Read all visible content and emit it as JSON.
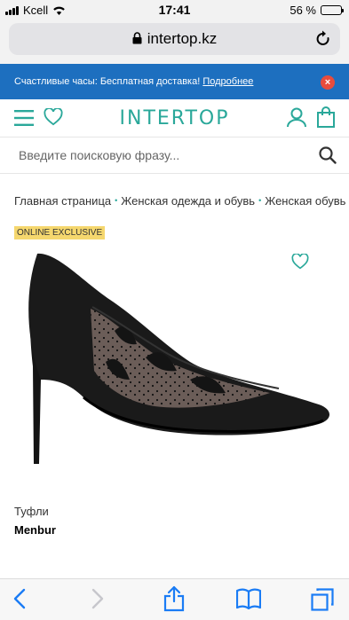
{
  "status": {
    "carrier": "Kcell",
    "time": "17:41",
    "battery": "56 %",
    "battery_level": 0.56
  },
  "browser": {
    "url": "intertop.kz"
  },
  "promo": {
    "text": "Счастливые часы: Бесплатная доставка!",
    "link": "Подробнее",
    "close": "×"
  },
  "header": {
    "logo": "INTERTOP"
  },
  "search": {
    "placeholder": "Введите поисковую фразу..."
  },
  "breadcrumb": [
    "Главная страница",
    "Женская одежда и обувь",
    "Женская обувь"
  ],
  "product": {
    "badge": "ONLINE EXCLUSIVE",
    "type": "Туфли",
    "brand": "Menbur"
  },
  "colors": {
    "promo_bg": "#1d6fbf",
    "accent": "#2aa89a",
    "badge_bg": "#f5d76e",
    "close_bg": "#e74c3c",
    "ios_blue": "#1a7cf5"
  }
}
